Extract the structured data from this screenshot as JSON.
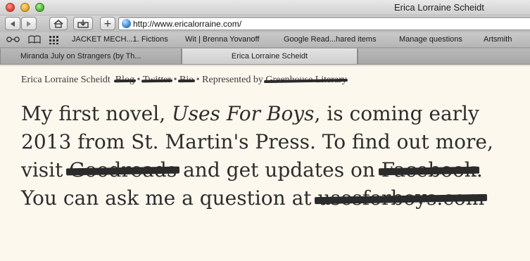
{
  "window": {
    "title": "Erica Lorraine Scheidt"
  },
  "toolbar": {
    "back_icon": "back-arrow-icon",
    "forward_icon": "forward-arrow-icon",
    "home_icon": "home-icon",
    "bookmark_icon": "add-bookmark-icon",
    "add_label": "+",
    "url": "http://www.ericalorraine.com/"
  },
  "bookmarks": {
    "items": [
      "JACKET MECH...1. Fictions",
      "Wit | Brenna Yovanoff",
      "Google Read...hared items",
      "Manage questions",
      "Artsmith"
    ]
  },
  "tabs": [
    {
      "label": "Miranda July on Strangers (by Th...",
      "active": false
    },
    {
      "label": "Erica Lorraine Scheidt",
      "active": true
    }
  ],
  "page": {
    "nav": {
      "name": "Erica Lorraine Scheidt",
      "blog": "Blog",
      "twitter": "Twitter",
      "bio": "Bio",
      "represented_by": "Represented by",
      "agency": "Greenhouse Literary",
      "separator": "•"
    },
    "headline": {
      "part1": "My first novel, ",
      "book_title": "Uses For Boys",
      "part2": ", is coming early 2013 from St. Martin's Press. To find out more, visit ",
      "goodreads": "Goodreads",
      "part3": " and get updates on ",
      "facebook": "Facebook",
      "part4": ". You can ask me a question at ",
      "site": "usesforboys.com"
    }
  }
}
